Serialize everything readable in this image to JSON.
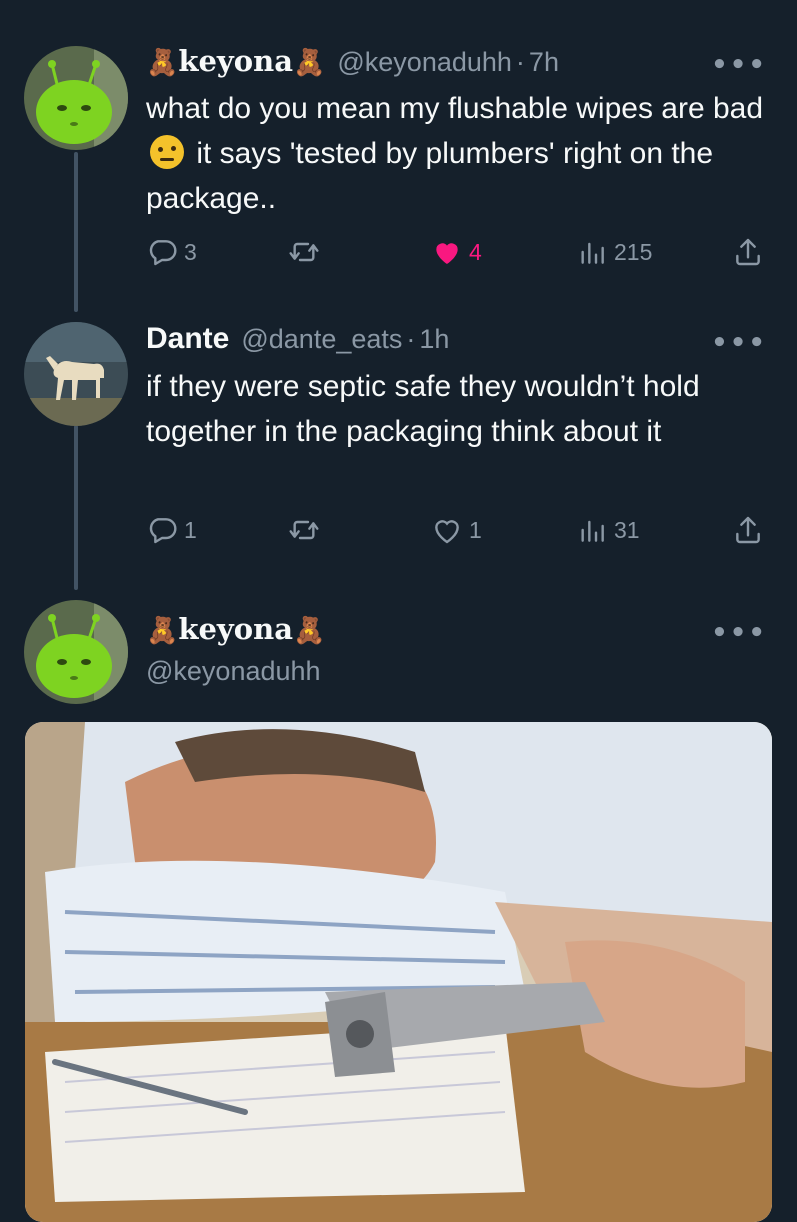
{
  "tweets": [
    {
      "display_name": "keyona",
      "handle": "@keyonaduhh",
      "separator": "·",
      "time": "7h",
      "text_parts": [
        "what do you mean my flushable wipes are bad",
        "it says 'tested by plumbers' right on the package.."
      ],
      "emoji_name": "face-with-raised-eyebrow",
      "stats": {
        "replies": "3",
        "reposts": "",
        "likes": "4",
        "views": "215"
      },
      "liked": true
    },
    {
      "display_name": "Dante",
      "handle": "@dante_eats",
      "separator": "·",
      "time": "1h",
      "text": "if they were septic safe they wouldn’t hold together in the packaging think about it",
      "stats": {
        "replies": "1",
        "reposts": "",
        "likes": "1",
        "views": "31"
      },
      "liked": false
    },
    {
      "display_name": "keyona",
      "handle": "@keyonaduhh",
      "media_description": "photo"
    }
  ],
  "icons": {
    "bear": "🧸",
    "more": "•••"
  },
  "colors": {
    "background": "#15202b",
    "text_primary": "#f7f9f9",
    "text_secondary": "#8b98a5",
    "like_active": "#f91880",
    "thread_line": "#425364"
  }
}
